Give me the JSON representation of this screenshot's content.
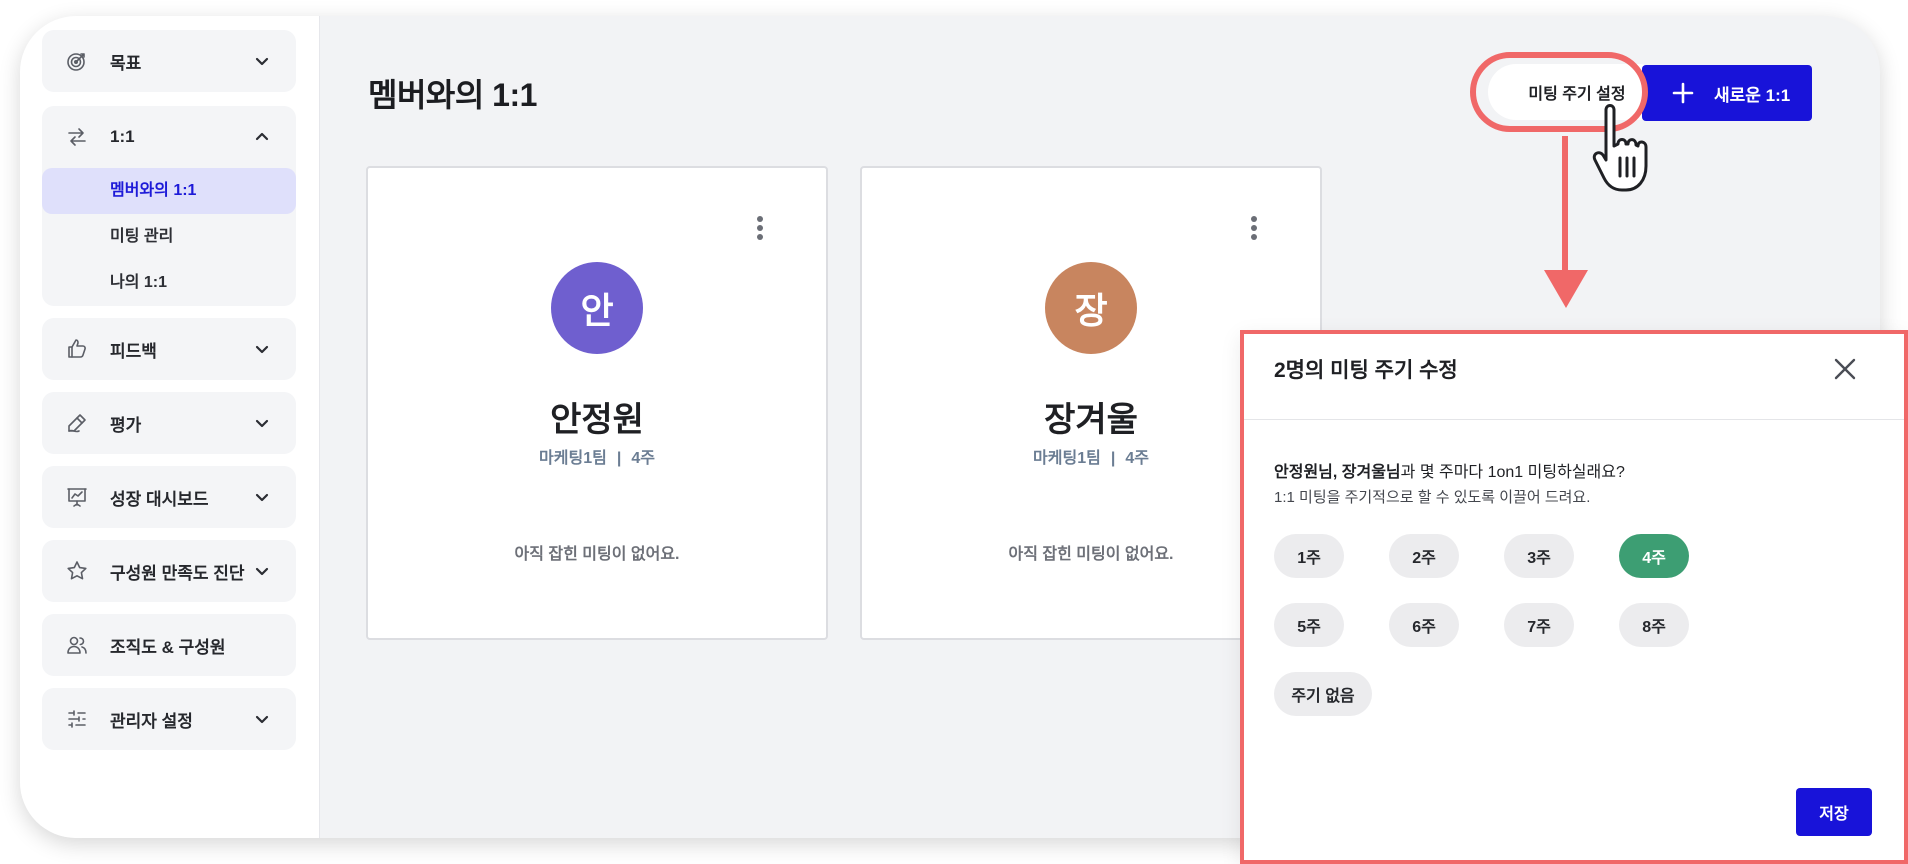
{
  "sidebar": {
    "items": [
      {
        "label": "목표",
        "icon": "target-icon",
        "expanded": false
      },
      {
        "label": "1:1",
        "icon": "swap-arrows-icon",
        "expanded": true,
        "children": [
          {
            "label": "멤버와의 1:1",
            "active": true
          },
          {
            "label": "미팅 관리",
            "active": false
          },
          {
            "label": "나의 1:1",
            "active": false
          }
        ]
      },
      {
        "label": "피드백",
        "icon": "thumbs-up-icon",
        "expanded": false
      },
      {
        "label": "평가",
        "icon": "pen-icon",
        "expanded": false
      },
      {
        "label": "성장 대시보드",
        "icon": "presentation-chart-icon",
        "expanded": false
      },
      {
        "label": "구성원 만족도 진단",
        "icon": "star-icon",
        "expanded": false
      },
      {
        "label": "조직도 & 구성원",
        "icon": "people-icon"
      },
      {
        "label": "관리자 설정",
        "icon": "sliders-icon",
        "expanded": false
      }
    ]
  },
  "main": {
    "title": "멤버와의 1:1",
    "period_button": "미팅 주기 설정",
    "new_button": "새로운 1:1",
    "cards": [
      {
        "initial": "안",
        "name": "안정원",
        "team": "마케팅1팀",
        "sep": "|",
        "period": "4주",
        "empty": "아직 잡힌 미팅이 없어요.",
        "avatar_color": "#6f5fcf"
      },
      {
        "initial": "장",
        "name": "장겨울",
        "team": "마케팅1팀",
        "sep": "|",
        "period": "4주",
        "empty": "아직 잡힌 미팅이 없어요.",
        "avatar_color": "#c8855f"
      }
    ]
  },
  "modal": {
    "title": "2명의 미팅 주기 수정",
    "question_names": "안정원님, 장겨울님",
    "question_rest": "과 몇 주마다 1on1 미팅하실래요?",
    "subtitle": "1:1 미팅을 주기적으로 할 수 있도록 이끌어 드려요.",
    "options": [
      "1주",
      "2주",
      "3주",
      "4주",
      "5주",
      "6주",
      "7주",
      "8주",
      "주기 없음"
    ],
    "selected": "4주",
    "save": "저장"
  },
  "colors": {
    "accent": "#1813d9",
    "selected_pill": "#3d9e73",
    "callout": "#f06868",
    "active_nav_bg": "#dfe0fb"
  }
}
